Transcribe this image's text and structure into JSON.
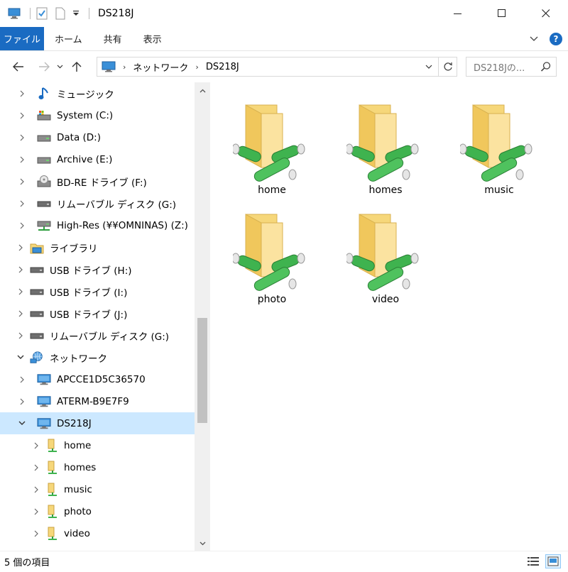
{
  "window": {
    "title": "DS218J"
  },
  "ribbon": {
    "tabs": [
      {
        "label": "ファイル",
        "active": true
      },
      {
        "label": "ホーム"
      },
      {
        "label": "共有"
      },
      {
        "label": "表示"
      }
    ],
    "help_label": "?"
  },
  "address": {
    "crumbs": [
      "ネットワーク",
      "DS218J"
    ],
    "search_placeholder": "DS218Jの..."
  },
  "nav": {
    "items": [
      {
        "label": "ミュージック",
        "icon": "music-note-icon",
        "level": 1
      },
      {
        "label": "System (C:)",
        "icon": "system-drive-icon",
        "level": 1
      },
      {
        "label": "Data (D:)",
        "icon": "drive-icon",
        "level": 1
      },
      {
        "label": "Archive (E:)",
        "icon": "drive-icon",
        "level": 1
      },
      {
        "label": "BD-RE ドライブ (F:)",
        "icon": "optical-drive-icon",
        "level": 1
      },
      {
        "label": "リムーバブル ディスク (G:)",
        "icon": "removable-drive-icon",
        "level": 1
      },
      {
        "label": "High-Res (¥¥OMNINAS) (Z:)",
        "icon": "network-drive-icon",
        "level": 1
      },
      {
        "label": "ライブラリ",
        "icon": "library-icon",
        "level": 0
      },
      {
        "label": "USB ドライブ (H:)",
        "icon": "removable-drive-icon",
        "level": 0
      },
      {
        "label": "USB ドライブ (I:)",
        "icon": "removable-drive-icon",
        "level": 0
      },
      {
        "label": "USB ドライブ (J:)",
        "icon": "removable-drive-icon",
        "level": 0
      },
      {
        "label": "リムーバブル ディスク (G:)",
        "icon": "removable-drive-icon",
        "level": 0
      },
      {
        "label": "ネットワーク",
        "icon": "network-icon",
        "level": 0,
        "expanded": true
      },
      {
        "label": "APCCE1D5C36570",
        "icon": "computer-icon",
        "level": 1
      },
      {
        "label": "ATERM-B9E7F9",
        "icon": "computer-icon",
        "level": 1
      },
      {
        "label": "DS218J",
        "icon": "computer-icon",
        "level": 1,
        "expanded": true,
        "selected": true
      },
      {
        "label": "home",
        "icon": "shared-folder-icon",
        "level": 2
      },
      {
        "label": "homes",
        "icon": "shared-folder-icon",
        "level": 2
      },
      {
        "label": "music",
        "icon": "shared-folder-icon",
        "level": 2
      },
      {
        "label": "photo",
        "icon": "shared-folder-icon",
        "level": 2
      },
      {
        "label": "video",
        "icon": "shared-folder-icon",
        "level": 2
      }
    ]
  },
  "content": {
    "folders": [
      "home",
      "homes",
      "music",
      "photo",
      "video"
    ]
  },
  "status": {
    "item_count": "5 個の項目"
  },
  "colors": {
    "accent": "#1a6bc2",
    "selection": "#cce8ff",
    "folder": "#f6d77a",
    "share_pipe": "#3fb34f"
  }
}
